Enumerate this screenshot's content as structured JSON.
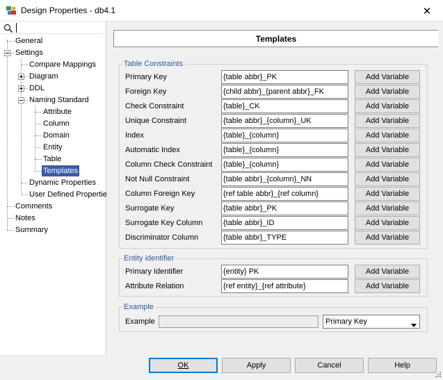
{
  "window": {
    "title": "Design Properties - db4.1",
    "close_glyph": "✕"
  },
  "search": {
    "value": "",
    "placeholder": ""
  },
  "tree": {
    "general": "General",
    "settings": "Settings",
    "compare_mappings": "Compare Mappings",
    "diagram": "Diagram",
    "ddl": "DDL",
    "naming_standard": "Naming Standard",
    "attribute": "Attribute",
    "column": "Column",
    "domain": "Domain",
    "entity": "Entity",
    "table": "Table",
    "templates": "Templates",
    "dynamic_properties": "Dynamic Properties",
    "user_defined_properties": "User Defined Propertie",
    "comments": "Comments",
    "notes": "Notes",
    "summary": "Summary"
  },
  "header": {
    "title": "Templates"
  },
  "table_constraints": {
    "legend": "Table Constraints",
    "rows": [
      {
        "label": "Primary Key",
        "value": "{table abbr}_PK",
        "button": "Add Variable"
      },
      {
        "label": "Foreign Key",
        "value": "{child abbr}_{parent abbr}_FK",
        "button": "Add Variable"
      },
      {
        "label": "Check Constraint",
        "value": "{table}_CK",
        "button": "Add Variable"
      },
      {
        "label": "Unique Constraint",
        "value": "{table abbr}_{column}_UK",
        "button": "Add Variable"
      },
      {
        "label": "Index",
        "value": "{table}_{column}",
        "button": "Add Variable"
      },
      {
        "label": "Automatic Index",
        "value": "{table}_{column}",
        "button": "Add Variable"
      },
      {
        "label": "Column Check Constraint",
        "value": "{table}_{column}",
        "button": "Add Variable"
      },
      {
        "label": "Not Null Constraint",
        "value": "{table abbr}_{column}_NN",
        "button": "Add Variable"
      },
      {
        "label": "Column Foreign Key",
        "value": "{ref table abbr}_{ref column}",
        "button": "Add Variable"
      },
      {
        "label": "Surrogate Key",
        "value": "{table abbr}_PK",
        "button": "Add Variable"
      },
      {
        "label": "Surrogate Key Column",
        "value": "{table abbr}_ID",
        "button": "Add Variable"
      },
      {
        "label": "Discriminator Column",
        "value": "{table abbr}_TYPE",
        "button": "Add Variable"
      }
    ]
  },
  "entity_identifier": {
    "legend": "Entity identifier",
    "rows": [
      {
        "label": "Primary Identifier",
        "value": "{entity} PK",
        "button": "Add Variable"
      },
      {
        "label": "Attribute Relation",
        "value": "{ref entity}_{ref attribute}",
        "button": "Add Variable"
      }
    ]
  },
  "example": {
    "legend": "Example",
    "label": "Example",
    "value": "",
    "select_value": "Primary Key"
  },
  "buttons": {
    "ok": "OK",
    "apply": "Apply",
    "cancel": "Cancel",
    "help": "Help"
  },
  "colors": {
    "selection": "#3c5ba7",
    "legend": "#2c5a9c",
    "default_button_border": "#0078d7"
  },
  "icons": [
    "app-icon",
    "close-icon",
    "search-icon",
    "expand-icon",
    "collapse-icon",
    "dropdown-arrow-icon",
    "resize-grip-icon"
  ]
}
